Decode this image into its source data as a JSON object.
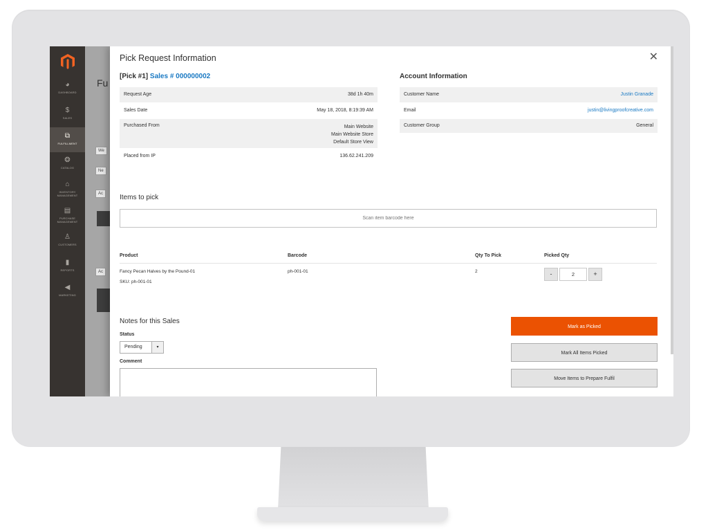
{
  "sidebar": {
    "items": [
      {
        "label": "Dashboard",
        "icon": "dashboard-icon",
        "glyph": "◕"
      },
      {
        "label": "Sales",
        "icon": "dollar-icon",
        "glyph": "$"
      },
      {
        "label": "Fulfillment",
        "icon": "boxes-icon",
        "glyph": "⧉"
      },
      {
        "label": "Catalog",
        "icon": "cube-icon",
        "glyph": "❂"
      },
      {
        "label": "Inventory Management",
        "icon": "warehouse-icon",
        "glyph": "⌂"
      },
      {
        "label": "Purchase Management",
        "icon": "clipboard-icon",
        "glyph": "▤"
      },
      {
        "label": "Customers",
        "icon": "person-icon",
        "glyph": "♙"
      },
      {
        "label": "Reports",
        "icon": "bar-chart-icon",
        "glyph": "▮"
      },
      {
        "label": "Marketing",
        "icon": "megaphone-icon",
        "glyph": "◀"
      }
    ]
  },
  "background": {
    "title_fragment": "Fu",
    "chips": [
      "We",
      "Ne",
      "Ac",
      "Ac"
    ]
  },
  "modal": {
    "title": "Pick Request Information",
    "pick_prefix": "[Pick #1]",
    "sales_link": "Sales # 000000002",
    "account_heading": "Account Information",
    "order_info": [
      {
        "label": "Request Age",
        "value": "38d 1h 40m"
      },
      {
        "label": "Sales Date",
        "value": "May 18, 2018, 8:19:39 AM"
      },
      {
        "label": "Purchased From",
        "value_lines": [
          "Main Website",
          "Main Website Store",
          "Default Store View"
        ]
      },
      {
        "label": "Placed from IP",
        "value": "136.62.241.209"
      }
    ],
    "account_info": [
      {
        "label": "Customer Name",
        "value": "Justin Granade"
      },
      {
        "label": "Email",
        "value": "justin@livingproofcreative.com"
      },
      {
        "label": "Customer Group",
        "value": "General"
      }
    ],
    "items_heading": "Items to pick",
    "scan_placeholder": "Scan item barcode here",
    "columns": [
      "Product",
      "Barcode",
      "Qty To Pick",
      "Picked Qty"
    ],
    "rows": [
      {
        "product": "Fancy Pecan Halves by the Pound-01",
        "sku": "SKU: ph-001-01",
        "barcode": "ph-001-01",
        "qty_to_pick": "2",
        "picked_qty": "2"
      }
    ],
    "stepper": {
      "minus": "-",
      "plus": "+"
    },
    "notes_heading": "Notes for this Sales",
    "status_label": "Status",
    "status_value": "Pending",
    "status_arrow": "▾",
    "comment_label": "Comment",
    "buttons": {
      "mark_picked": "Mark as Picked",
      "mark_all": "Mark All Items Picked",
      "move_items": "Move Items to Prepare Fulfil"
    },
    "close_glyph": "✕"
  },
  "colors": {
    "accent_orange": "#eb5202",
    "link_blue": "#1979c3",
    "sidebar_dark": "#373330"
  }
}
